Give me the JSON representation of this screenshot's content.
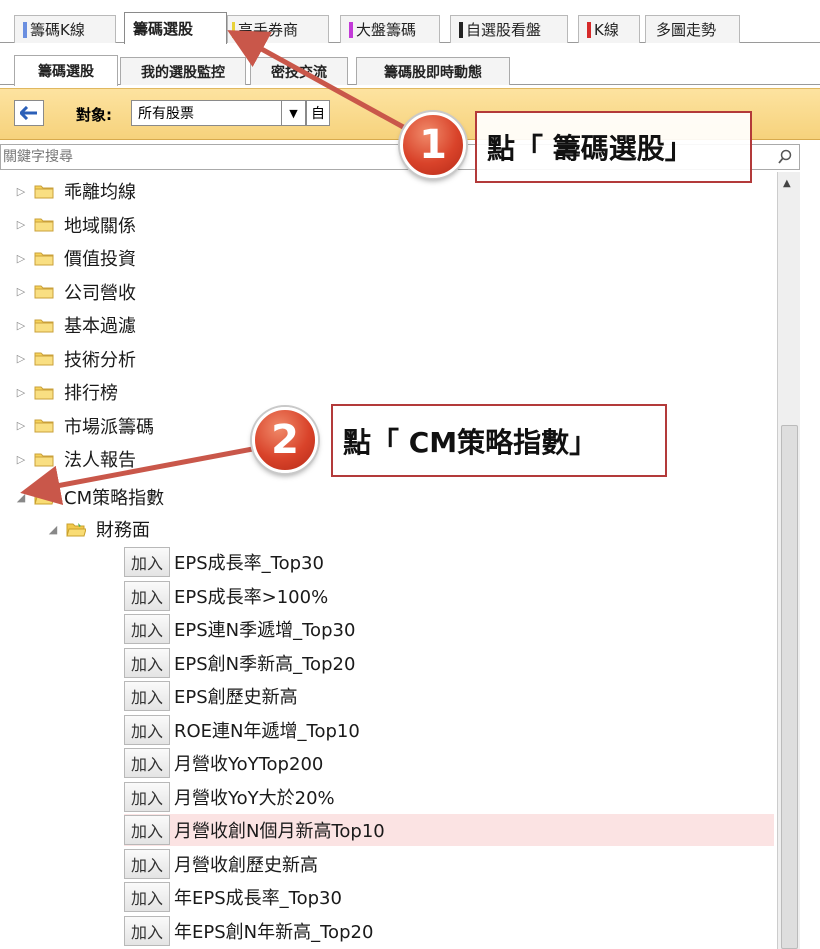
{
  "top_tabs": [
    {
      "label": "籌碼K線",
      "bar_color": "#6b8fe0"
    },
    {
      "label": "籌碼選股",
      "bar_color": "",
      "active": true
    },
    {
      "label": "高手券商",
      "bar_color": "#e8d23a"
    },
    {
      "label": "大盤籌碼",
      "bar_color": "#c33ad8"
    },
    {
      "label": "自選股看盤",
      "bar_color": "#222222"
    },
    {
      "label": "K線",
      "bar_color": "#d62a2a"
    },
    {
      "label": "多圖走勢",
      "bar_color": ""
    }
  ],
  "sub_tabs": [
    {
      "label": "籌碼選股",
      "active": true
    },
    {
      "label": "我的選股監控"
    },
    {
      "label": "密技交流"
    },
    {
      "label": "籌碼股即時動態"
    }
  ],
  "toolbar": {
    "target_label": "對象:",
    "target_value": "所有股票",
    "self_label": "自"
  },
  "search": {
    "placeholder": "關鍵字搜尋"
  },
  "tree": {
    "folders": [
      "乖離均線",
      "地域關係",
      "價值投資",
      "公司營收",
      "基本過濾",
      "技術分析",
      "排行榜",
      "市場派籌碼",
      "法人報告"
    ],
    "expanded_folder": "CM策略指數",
    "sub_folder": "財務面",
    "add_label": "加入",
    "items": [
      "EPS成長率_Top30",
      "EPS成長率>100%",
      "EPS連N季遞增_Top30",
      "EPS創N季新高_Top20",
      "EPS創歷史新高",
      "ROE連N年遞增_Top10",
      "月營收YoYTop200",
      "月營收YoY大於20%",
      "月營收創N個月新高Top10",
      "月營收創歷史新高",
      "年EPS成長率_Top30",
      "年EPS創N年新高_Top20"
    ]
  },
  "callouts": [
    {
      "number": "1",
      "text": "點「 籌碼選股」"
    },
    {
      "number": "2",
      "text": "點「 CM策略指數」"
    }
  ],
  "colors": {
    "toolbar_bg": "#f6d27c",
    "highlight_row": "#fbe3e3",
    "callout_red": "#d9432a",
    "arrow_red": "#c9574a"
  }
}
